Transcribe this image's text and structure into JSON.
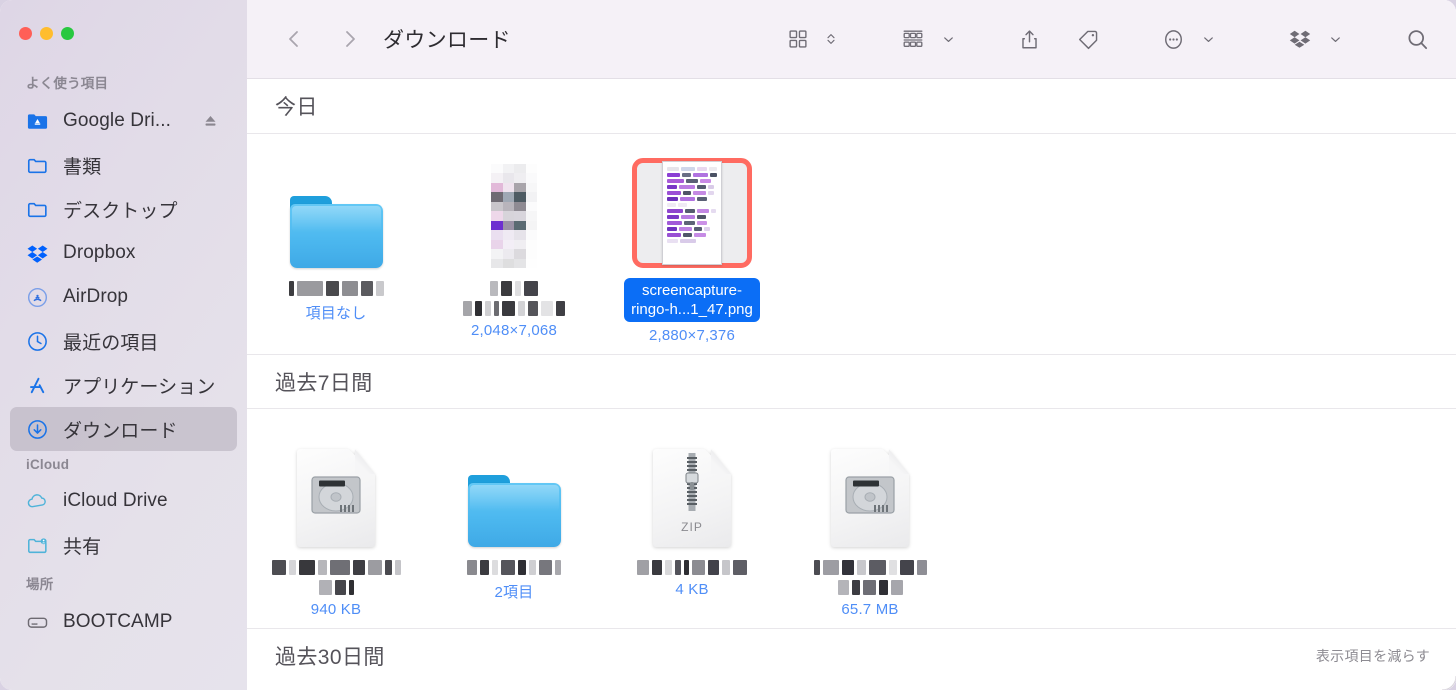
{
  "window": {
    "traffic_lights": [
      {
        "name": "close",
        "color": "#ff5f57"
      },
      {
        "name": "minimize",
        "color": "#ffbd2e"
      },
      {
        "name": "maximize",
        "color": "#28c840"
      }
    ]
  },
  "sidebar": {
    "sections": [
      {
        "header": "よく使う項目",
        "items": [
          {
            "label": "Google Dri...",
            "icon": "google-drive-folder-icon",
            "eject": true,
            "selected": false
          },
          {
            "label": "書類",
            "icon": "folder-icon",
            "eject": false,
            "selected": false
          },
          {
            "label": "デスクトップ",
            "icon": "folder-icon",
            "eject": false,
            "selected": false
          },
          {
            "label": "Dropbox",
            "icon": "dropbox-icon",
            "eject": false,
            "selected": false
          },
          {
            "label": "AirDrop",
            "icon": "airdrop-icon",
            "eject": false,
            "selected": false
          },
          {
            "label": "最近の項目",
            "icon": "clock-icon",
            "eject": false,
            "selected": false
          },
          {
            "label": "アプリケーション",
            "icon": "applications-icon",
            "eject": false,
            "selected": false
          },
          {
            "label": "ダウンロード",
            "icon": "downloads-icon",
            "eject": false,
            "selected": true
          }
        ]
      },
      {
        "header": "iCloud",
        "items": [
          {
            "label": "iCloud Drive",
            "icon": "cloud-icon",
            "eject": false,
            "selected": false
          },
          {
            "label": "共有",
            "icon": "shared-folder-icon",
            "eject": false,
            "selected": false
          }
        ]
      },
      {
        "header": "場所",
        "items": [
          {
            "label": "BOOTCAMP",
            "icon": "hard-drive-icon",
            "eject": false,
            "selected": false
          }
        ]
      }
    ]
  },
  "toolbar": {
    "back_icon": "chevron-left-icon",
    "forward_icon": "chevron-right-icon",
    "title": "ダウンロード",
    "buttons": [
      {
        "name": "icon-view-button",
        "icon": "grid-view-icon"
      },
      {
        "name": "view-options-stepper",
        "icon": "chevron-up-down-icon"
      },
      {
        "name": "group-by-button",
        "icon": "group-rows-icon"
      },
      {
        "name": "group-by-chevron",
        "icon": "chevron-down-icon"
      },
      {
        "name": "share-button",
        "icon": "share-icon"
      },
      {
        "name": "tag-button",
        "icon": "tag-icon"
      },
      {
        "name": "more-actions-button",
        "icon": "ellipsis-circle-icon"
      },
      {
        "name": "more-actions-chevron",
        "icon": "chevron-down-icon"
      },
      {
        "name": "dropbox-button",
        "icon": "dropbox-icon"
      },
      {
        "name": "dropbox-chevron",
        "icon": "chevron-down-icon"
      },
      {
        "name": "search-button",
        "icon": "search-icon"
      }
    ]
  },
  "content": {
    "groups": [
      {
        "title": "今日",
        "action": "",
        "items": [
          {
            "kind": "folder",
            "name_redacted": true,
            "name_lines": [],
            "meta": "項目なし",
            "selected": false
          },
          {
            "kind": "pixelated-image",
            "name_redacted": true,
            "name_lines": [],
            "meta": "2,048×7,068",
            "selected": false
          },
          {
            "kind": "screenshot-png",
            "name_redacted": false,
            "name_lines": [
              "screencapture-",
              "ringo-h...1_47.png"
            ],
            "meta": "2,880×7,376",
            "selected": true
          }
        ]
      },
      {
        "title": "過去7日間",
        "action": "",
        "items": [
          {
            "kind": "disk-image",
            "name_redacted": true,
            "name_lines": [],
            "meta": "940 KB",
            "selected": false
          },
          {
            "kind": "folder",
            "name_redacted": true,
            "name_lines": [],
            "meta": "2項目",
            "selected": false
          },
          {
            "kind": "zip",
            "name_redacted": true,
            "name_lines": [],
            "meta": "4 KB",
            "selected": false
          },
          {
            "kind": "disk-image",
            "name_redacted": true,
            "name_lines": [],
            "meta": "65.7 MB",
            "selected": false
          }
        ]
      },
      {
        "title": "過去30日間",
        "action": "表示項目を減らす",
        "items": []
      }
    ]
  },
  "colors": {
    "selection_blue": "#0b6ef6",
    "meta_blue": "#4f8ef7",
    "highlight_red": "#ff6b61",
    "sidebar_bg": "#e2dce8",
    "toolbar_bg": "#f5f1f7"
  }
}
